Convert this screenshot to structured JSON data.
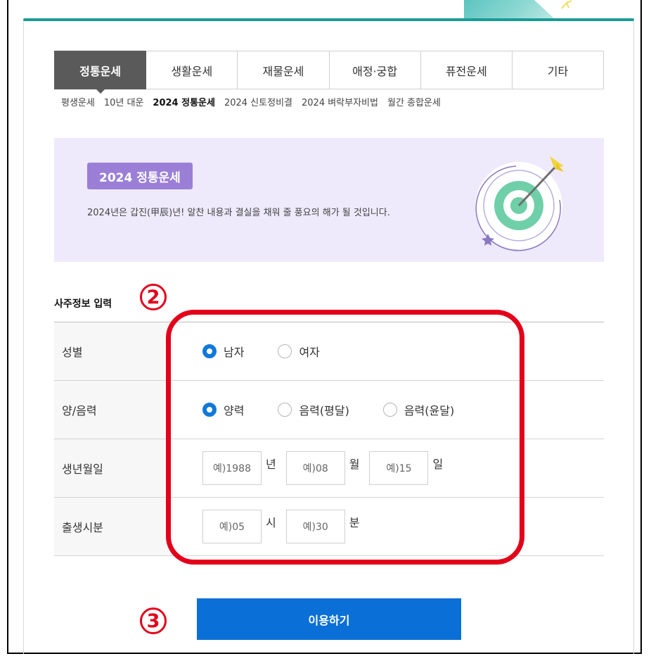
{
  "tabs": [
    {
      "label": "정통운세",
      "active": true
    },
    {
      "label": "생활운세",
      "active": false
    },
    {
      "label": "재물운세",
      "active": false
    },
    {
      "label": "애정·궁합",
      "active": false
    },
    {
      "label": "퓨전운세",
      "active": false
    },
    {
      "label": "기타",
      "active": false
    }
  ],
  "subnav": [
    {
      "label": "평생운세",
      "active": false
    },
    {
      "label": "10년 대운",
      "active": false
    },
    {
      "label": "2024 정통운세",
      "active": true
    },
    {
      "label": "2024 신토정비결",
      "active": false
    },
    {
      "label": "2024 벼락부자비법",
      "active": false
    },
    {
      "label": "월간 종합운세",
      "active": false
    }
  ],
  "banner": {
    "badge": "2024 정통운세",
    "description": "2024년은 갑진(甲辰)년! 알찬 내용과 결실을 채워 줄 풍요의 해가 될 것입니다."
  },
  "section": {
    "title": "사주정보 입력"
  },
  "annotations": {
    "step2": "2",
    "step3": "3"
  },
  "form": {
    "gender": {
      "label": "성별",
      "options": [
        "남자",
        "여자"
      ],
      "selected": "남자"
    },
    "calendar": {
      "label": "양/음력",
      "options": [
        "양력",
        "음력(평달)",
        "음력(윤달)"
      ],
      "selected": "양력"
    },
    "birthdate": {
      "label": "생년월일",
      "year_placeholder": "예)1988",
      "year_unit": "년",
      "month_placeholder": "예)08",
      "month_unit": "월",
      "day_placeholder": "예)15",
      "day_unit": "일"
    },
    "birthtime": {
      "label": "출생시분",
      "hour_placeholder": "예)05",
      "hour_unit": "시",
      "minute_placeholder": "예)30",
      "minute_unit": "분"
    }
  },
  "submit": {
    "label": "이용하기"
  },
  "colors": {
    "accent_teal": "#1a9b94",
    "tab_active": "#5a5a5a",
    "banner_bg": "#eeeafc",
    "badge_purple": "#9b7fd7",
    "radio_blue": "#1278d9",
    "submit_blue": "#0a6fd6",
    "annotation_red": "#e3001b"
  },
  "icons": {
    "banner": "target-arrow-icon",
    "decoration": "sparkle-icon"
  }
}
